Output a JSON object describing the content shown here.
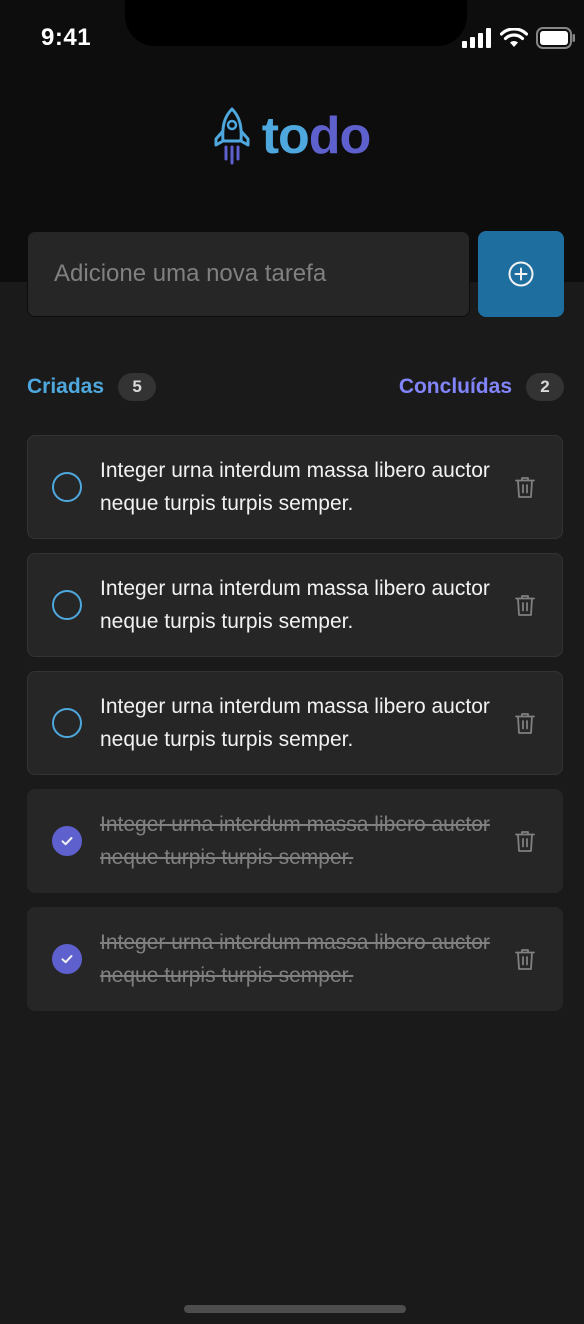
{
  "status_bar": {
    "time": "9:41"
  },
  "logo": {
    "part1": "to",
    "part2": "do"
  },
  "new_task": {
    "placeholder": "Adicione uma nova tarefa"
  },
  "counters": {
    "created_label": "Criadas",
    "created_count": "5",
    "done_label": "Concluídas",
    "done_count": "2"
  },
  "tasks": [
    {
      "text": "Integer urna interdum massa libero auctor neque turpis turpis semper.",
      "done": false
    },
    {
      "text": "Integer urna interdum massa libero auctor neque turpis turpis semper.",
      "done": false
    },
    {
      "text": "Integer urna interdum massa libero auctor neque turpis turpis semper.",
      "done": false
    },
    {
      "text": "Integer urna interdum massa libero auctor neque turpis turpis semper.",
      "done": true
    },
    {
      "text": "Integer urna interdum massa libero auctor neque turpis turpis semper.",
      "done": true
    }
  ],
  "colors": {
    "blue": "#4ea8de",
    "purple": "#5e60ce",
    "purple_light": "#8284fa",
    "blue_dark": "#1e6f9f"
  },
  "icons": {
    "logo": "rocket-icon",
    "add": "plus-circle-icon",
    "delete": "trash-icon",
    "check": "check-icon"
  }
}
